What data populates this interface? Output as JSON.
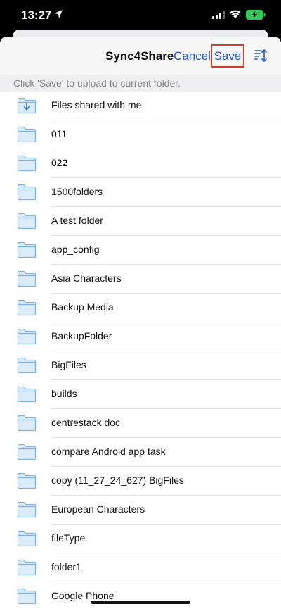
{
  "status_bar": {
    "time": "13:27"
  },
  "nav": {
    "title": "Sync4Share",
    "cancel": "Cancel",
    "save": "Save"
  },
  "hint": "Click 'Save' to upload to current folder.",
  "folders": [
    {
      "name": "Files shared with me",
      "icon": "shared-folder-icon"
    },
    {
      "name": "011",
      "icon": "folder-icon"
    },
    {
      "name": "022",
      "icon": "folder-icon"
    },
    {
      "name": "1500folders",
      "icon": "folder-icon"
    },
    {
      "name": "A test folder",
      "icon": "folder-icon"
    },
    {
      "name": "app_config",
      "icon": "folder-icon"
    },
    {
      "name": "Asia Characters",
      "icon": "folder-icon"
    },
    {
      "name": "Backup Media",
      "icon": "folder-icon"
    },
    {
      "name": "BackupFolder",
      "icon": "folder-icon"
    },
    {
      "name": "BigFiles",
      "icon": "folder-icon"
    },
    {
      "name": "builds",
      "icon": "folder-icon"
    },
    {
      "name": "centrestack doc",
      "icon": "folder-icon"
    },
    {
      "name": "compare Android app task",
      "icon": "folder-icon"
    },
    {
      "name": "copy (11_27_24_627) BigFiles",
      "icon": "folder-icon"
    },
    {
      "name": "European Characters",
      "icon": "folder-icon"
    },
    {
      "name": "fileType",
      "icon": "folder-icon"
    },
    {
      "name": "folder1",
      "icon": "folder-icon"
    },
    {
      "name": "Google Phone",
      "icon": "folder-icon"
    }
  ],
  "colors": {
    "accent": "#2557c9",
    "highlight": "#d23b26",
    "folder_fill": "#dcebf8",
    "folder_stroke": "#7fb2e0"
  }
}
